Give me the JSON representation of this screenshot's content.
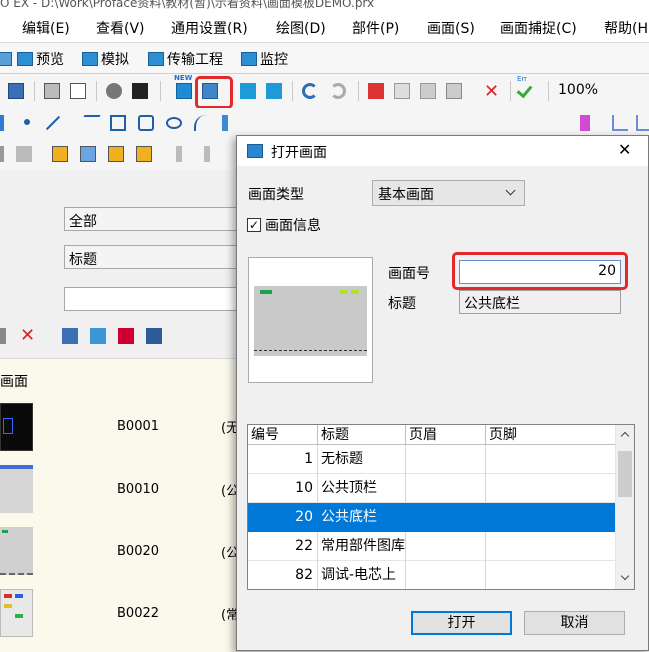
{
  "window": {
    "title": "O EX - D:\\Work\\Proface资料\\教材(暂)\\示看资料\\画面模板DEMO.prx"
  },
  "menu": [
    "编辑(E)",
    "查看(V)",
    "通用设置(R)",
    "绘图(D)",
    "部件(P)",
    "画面(S)",
    "画面捕捉(C)",
    "帮助(H"
  ],
  "tabs": [
    {
      "label": "预览",
      "icon": "preview-icon"
    },
    {
      "label": "模拟",
      "icon": "simulate-icon"
    },
    {
      "label": "传输工程",
      "icon": "transfer-icon"
    },
    {
      "label": "监控",
      "icon": "monitor-icon"
    }
  ],
  "toolbar": {
    "zoom": "100%",
    "new_badge": "NEW",
    "err_badge": "Err"
  },
  "left_panel": {
    "field1": "全部",
    "field2": "标题",
    "field3": "",
    "list_header": "画面",
    "rows": [
      {
        "id": "B0001",
        "title": "(无"
      },
      {
        "id": "B0010",
        "title": "(公"
      },
      {
        "id": "B0020",
        "title": "(公"
      },
      {
        "id": "B0022",
        "title": "(常"
      }
    ]
  },
  "dialog": {
    "title": "打开画面",
    "type_label": "画面类型",
    "type_value": "基本画面",
    "info_checkbox_label": "画面信息",
    "info_checked": true,
    "number_label": "画面号",
    "number_value": "20",
    "title_label": "标题",
    "title_value": "公共底栏",
    "table": {
      "columns": [
        "编号",
        "标题",
        "页眉",
        "页脚"
      ],
      "rows": [
        {
          "no": "1",
          "title": "无标题",
          "header": "",
          "footer": "",
          "selected": false
        },
        {
          "no": "10",
          "title": "公共顶栏",
          "header": "",
          "footer": "",
          "selected": false
        },
        {
          "no": "20",
          "title": "公共底栏",
          "header": "",
          "footer": "",
          "selected": true
        },
        {
          "no": "22",
          "title": "常用部件图库",
          "header": "",
          "footer": "",
          "selected": false
        },
        {
          "no": "82",
          "title": "调试-电芯上",
          "header": "",
          "footer": "",
          "selected": false
        }
      ]
    },
    "open_button": "打开",
    "cancel_button": "取消",
    "close_glyph": "✕",
    "check_glyph": "✓"
  },
  "colors": {
    "highlight": "#e12a2a",
    "selection": "#0078d7"
  }
}
